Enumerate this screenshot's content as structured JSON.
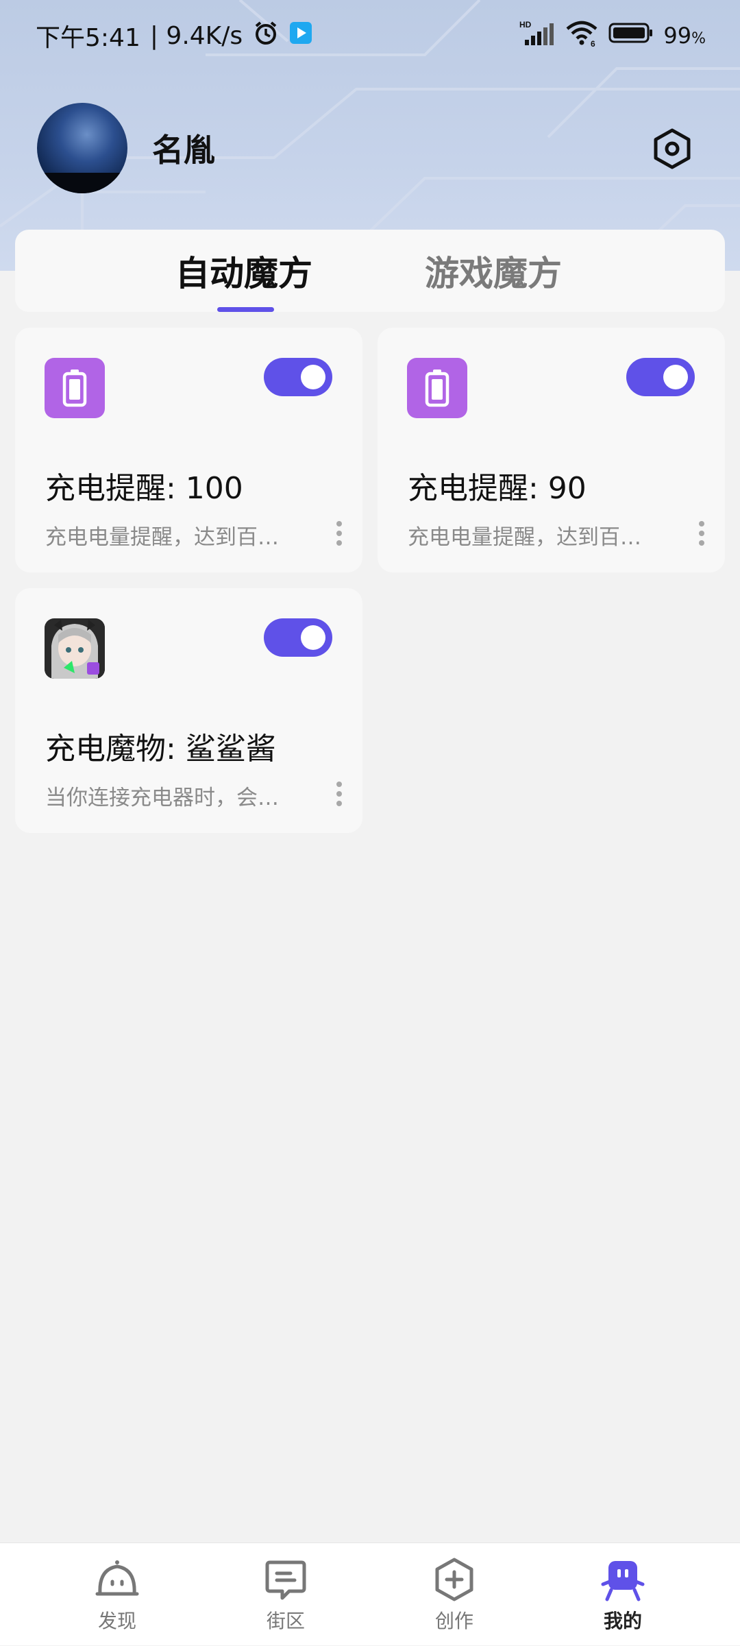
{
  "status_bar": {
    "time": "下午5:41",
    "speed": "| 9.4K/s",
    "battery_percent": "99",
    "battery_unit": "%"
  },
  "profile": {
    "username": "名胤"
  },
  "tabs": [
    {
      "label": "自动魔方",
      "active": true
    },
    {
      "label": "游戏魔方",
      "active": false
    }
  ],
  "cards": [
    {
      "title": "充电提醒: 100",
      "description": "充电电量提醒，达到百分比时提醒",
      "icon": "battery-icon",
      "enabled": true
    },
    {
      "title": "充电提醒: 90",
      "description": "充电电量提醒，达到百分比时提醒",
      "icon": "battery-icon",
      "enabled": true
    },
    {
      "title": "充电魔物: 鲨鲨酱",
      "description": "当你连接充电器时，会出现动画",
      "icon": "anime-character-thumbnail",
      "enabled": true
    }
  ],
  "bottom_nav": [
    {
      "label": "发现",
      "icon": "discover-icon",
      "active": false
    },
    {
      "label": "街区",
      "icon": "street-icon",
      "active": false
    },
    {
      "label": "创作",
      "icon": "create-icon",
      "active": false
    },
    {
      "label": "我的",
      "icon": "mine-icon",
      "active": true
    }
  ],
  "colors": {
    "accent": "#5f51e8",
    "icon_purple": "#b164e6",
    "header_bg": "#c6d3ea"
  }
}
